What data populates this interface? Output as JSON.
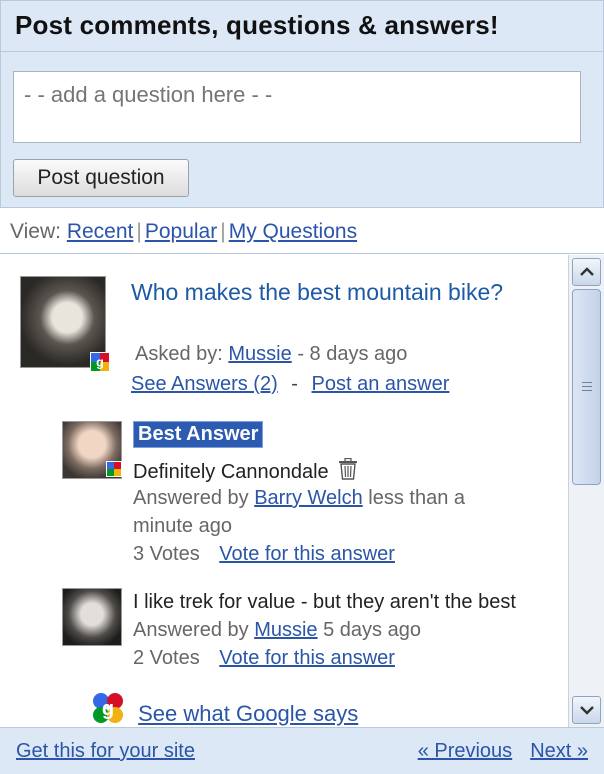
{
  "header": {
    "title": "Post comments, questions & answers!",
    "question_placeholder": "- - add a question here - -",
    "post_button_label": "Post question"
  },
  "view": {
    "label": "View:",
    "options": [
      "Recent",
      "Popular",
      "My Questions"
    ],
    "separator": "|"
  },
  "question": {
    "title": "Who makes the best mountain bike?",
    "asked_by_label": "Asked by:",
    "author": "Mussie",
    "age": "- 8 days ago",
    "see_answers": "See Answers (2)",
    "links_separator": "-",
    "post_answer": "Post an answer"
  },
  "answers": [
    {
      "badge": "Best Answer",
      "text": "Definitely Cannondale",
      "answered_by_label": "Answered by",
      "author": "Barry Welch",
      "age_line1": "less than a",
      "age_line2": "minute ago",
      "votes": "3 Votes",
      "vote_link": "Vote for this answer"
    },
    {
      "text": "I like trek for value - but they aren't the best",
      "answered_by_label": "Answered by",
      "author": "Mussie",
      "age": "5 days ago",
      "votes": "2 Votes",
      "vote_link": "Vote for this answer"
    }
  ],
  "google_link": "See what Google says",
  "footer": {
    "site_link": "Get this for your site",
    "previous": "« Previous",
    "next": "Next »"
  },
  "colors": {
    "panel_bg": "#dde8f6",
    "link": "#2a55a8",
    "question_title": "#1d5aa6",
    "best_badge": "#2d5bb2"
  },
  "icons": [
    "trash-icon",
    "google-badge-icon",
    "scroll-up-arrow-icon",
    "scroll-down-arrow-icon",
    "scroll-grip-icon"
  ]
}
